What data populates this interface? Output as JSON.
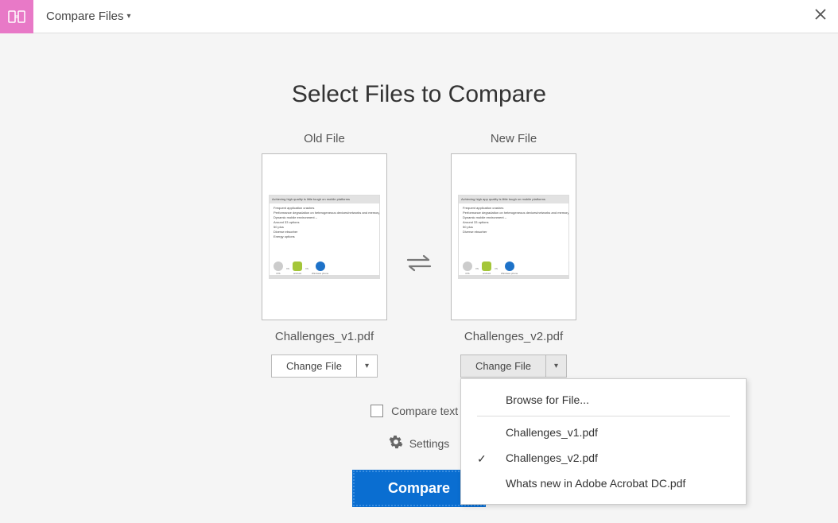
{
  "header": {
    "title": "Compare Files"
  },
  "main": {
    "title": "Select Files to Compare",
    "old": {
      "label": "Old File",
      "filename": "Challenges_v1.pdf",
      "change_btn": "Change File"
    },
    "new": {
      "label": "New File",
      "filename": "Challenges_v2.pdf",
      "change_btn": "Change File"
    },
    "compare_text_label": "Compare text o",
    "settings_label": "Settings",
    "compare_btn": "Compare"
  },
  "dropdown": {
    "browse": "Browse for File...",
    "items": [
      {
        "label": "Challenges_v1.pdf",
        "checked": false
      },
      {
        "label": "Challenges_v2.pdf",
        "checked": true
      },
      {
        "label": "Whats new in Adobe Acrobat DC.pdf",
        "checked": false
      }
    ]
  },
  "preview": {
    "old_title": "Achieving high quality is little tough on mobile platforms",
    "new_title": "Achieving high app quality is little tough on mobile platforms",
    "lines": [
      "Frequent application crashes",
      "Performance degradation on heterogeneous devices/networks and memory leaked",
      "Dynamic mobile environment –",
      "  Around 33 options",
      "  50 plus",
      "  Diverse ebsorber",
      "  Energy options"
    ],
    "os": {
      "ios": "iOS",
      "android": "android",
      "windows": "Windows phone",
      "vs": "vs"
    }
  }
}
